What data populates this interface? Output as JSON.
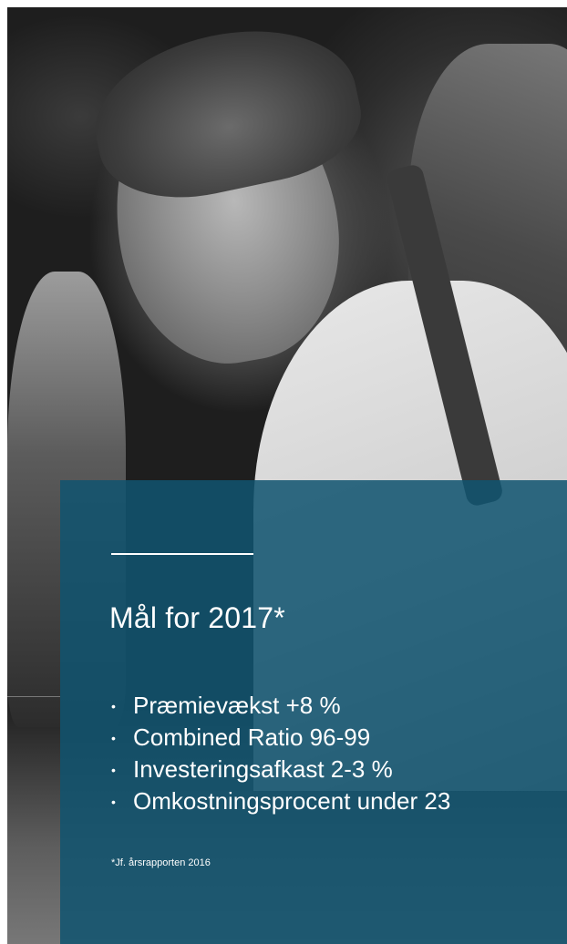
{
  "panel": {
    "title": "Mål for 2017*",
    "goals": [
      {
        "bullet": "•",
        "label": "Præmievækst +8 %"
      },
      {
        "bullet": "•",
        "label": "Combined Ratio 96-99"
      },
      {
        "bullet": "•",
        "label": "Investeringsafkast 2-3 %"
      },
      {
        "bullet": "•",
        "label": "Omkostningsprocent under 23"
      }
    ],
    "footnote": "*Jf. årsrapporten 2016"
  },
  "colors": {
    "panel_bg": "#105470",
    "text": "#ffffff"
  }
}
